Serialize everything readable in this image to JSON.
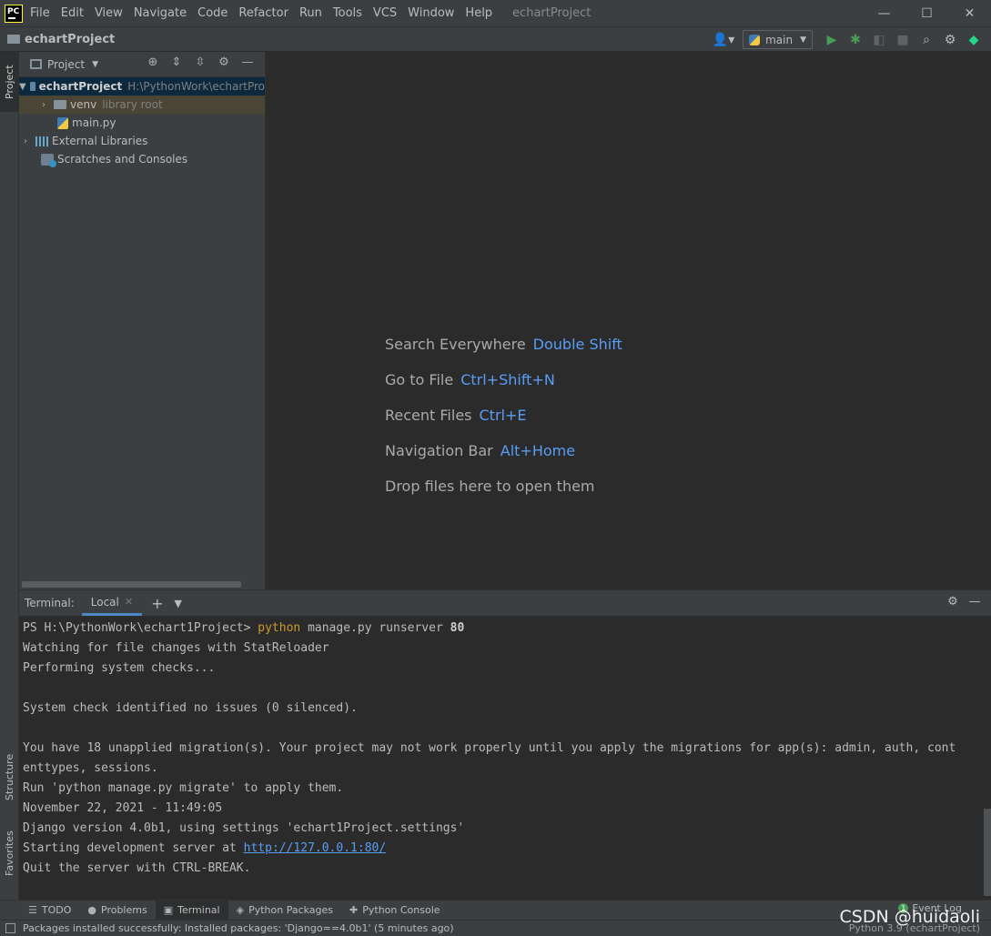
{
  "app": {
    "logo": "PC",
    "window_title": "echartProject",
    "menu": [
      "File",
      "Edit",
      "View",
      "Navigate",
      "Code",
      "Refactor",
      "Run",
      "Tools",
      "VCS",
      "Window",
      "Help"
    ],
    "win_controls": [
      "—",
      "☐",
      "✕"
    ]
  },
  "navbar": {
    "project": "echartProject",
    "run_config": "main"
  },
  "left_strip": {
    "project_tab": "Project",
    "structure_tab": "Structure",
    "favorites_tab": "Favorites"
  },
  "project_panel": {
    "title": "Project",
    "tree": {
      "root_name": "echartProject",
      "root_path": "H:\\PythonWork\\echartPro",
      "venv_name": "venv",
      "venv_note": "library root",
      "main_file": "main.py",
      "external_libraries": "External Libraries",
      "scratches": "Scratches and Consoles"
    }
  },
  "editor_hints": {
    "search_label": "Search Everywhere",
    "search_key": "Double Shift",
    "goto_label": "Go to File",
    "goto_key": "Ctrl+Shift+N",
    "recent_label": "Recent Files",
    "recent_key": "Ctrl+E",
    "navbar_label": "Navigation Bar",
    "navbar_key": "Alt+Home",
    "drop_label": "Drop files here to open them"
  },
  "terminal": {
    "label": "Terminal:",
    "tab": "Local",
    "prompt": "PS H:\\PythonWork\\echart1Project> ",
    "cmd_keyword": "python",
    "cmd_rest": " manage.py runserver ",
    "cmd_port": "80",
    "lines": {
      "l2": "Watching for file changes with StatReloader",
      "l3": "Performing system checks...",
      "l5": "System check identified no issues (0 silenced).",
      "l7": "You have 18 unapplied migration(s). Your project may not work properly until you apply the migrations for app(s): admin, auth, cont",
      "l8": "enttypes, sessions.",
      "l9": "Run 'python manage.py migrate' to apply them.",
      "l10": "November 22, 2021 - 11:49:05",
      "l11": "Django version 4.0b1, using settings 'echart1Project.settings'",
      "l12_prefix": "Starting development server at ",
      "l12_link": "http://127.0.0.1:80/",
      "l13": "Quit the server with CTRL-BREAK."
    }
  },
  "bottom_bar": {
    "todo": "TODO",
    "problems": "Problems",
    "terminal": "Terminal",
    "python_packages": "Python Packages",
    "python_console": "Python Console",
    "event_log_count": "1",
    "event_log": "Event Log"
  },
  "statusbar": {
    "message": "Packages installed successfully: Installed packages: 'Django==4.0b1' (5 minutes ago)",
    "interpreter": "Python 3.9 (echartProject)"
  },
  "watermark": "CSDN @huidaoli"
}
